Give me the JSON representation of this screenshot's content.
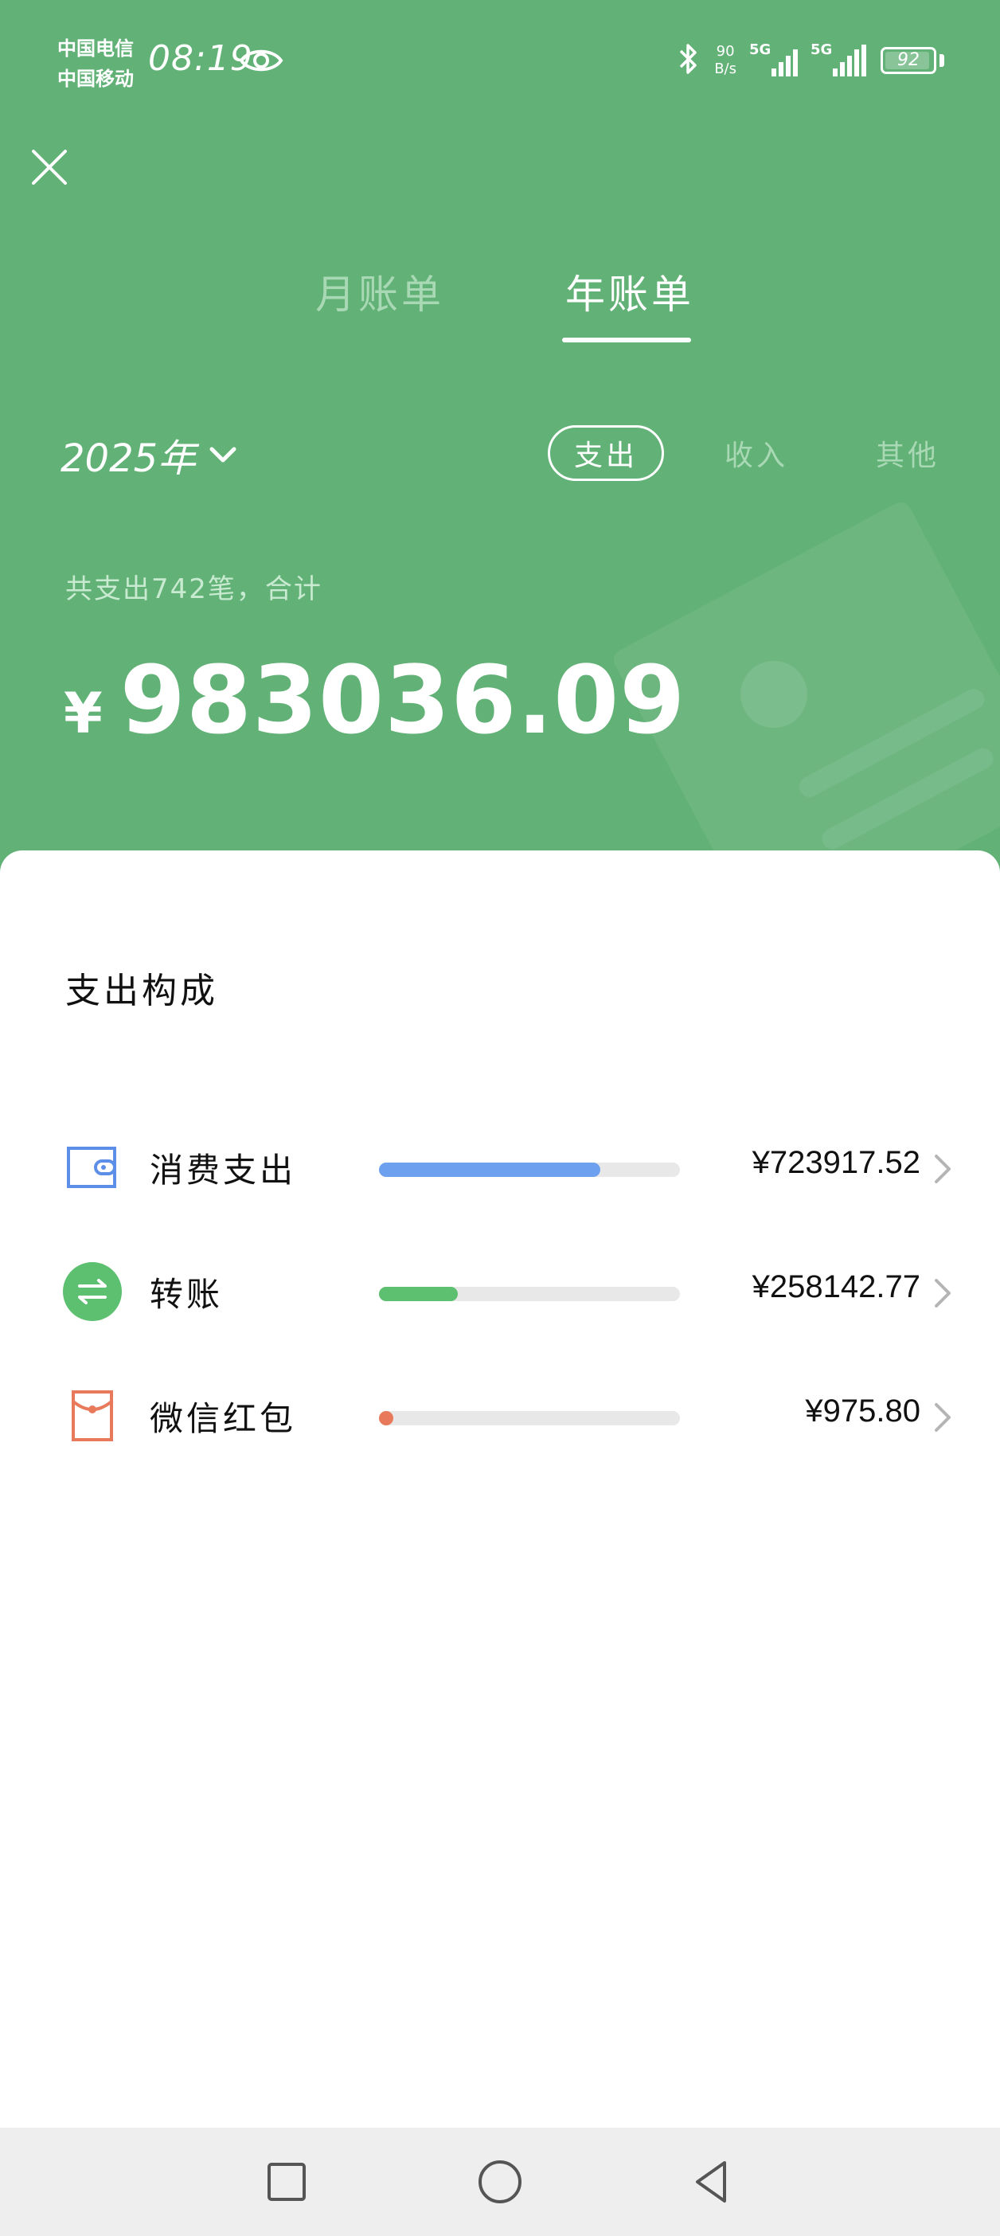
{
  "status_bar": {
    "carrier1": "中国电信",
    "carrier2": "中国移动",
    "time": "08:19",
    "net_speed_value": "90",
    "net_speed_unit": "B/s",
    "signal1_label": "5G",
    "signal2_label": "5G",
    "battery": "92",
    "icons": [
      "eye-icon",
      "bluetooth-icon",
      "signal-icon",
      "battery-icon"
    ]
  },
  "header": {
    "tabs": [
      {
        "label": "月账单",
        "active": false
      },
      {
        "label": "年账单",
        "active": true
      }
    ],
    "year_label": "2025年",
    "filters": [
      {
        "label": "支出",
        "active": true
      },
      {
        "label": "收入",
        "active": false
      },
      {
        "label": "其他",
        "active": false
      }
    ],
    "summary": "共支出742笔，合计",
    "currency": "¥",
    "total": "983036.09"
  },
  "breakdown": {
    "title": "支出构成",
    "items": [
      {
        "label": "消费支出",
        "amount": "¥723917.52",
        "fraction": 0.736,
        "color": "#6ea0f0",
        "icon": "wallet-icon"
      },
      {
        "label": "转账",
        "amount": "¥258142.77",
        "fraction": 0.263,
        "color": "#5dbf70",
        "icon": "transfer-icon"
      },
      {
        "label": "微信红包",
        "amount": "¥975.80",
        "fraction": 0.001,
        "color": "#e8795b",
        "icon": "red-packet-icon"
      }
    ]
  },
  "colors": {
    "header_bg": "#62b177",
    "text_primary": "#111111"
  }
}
